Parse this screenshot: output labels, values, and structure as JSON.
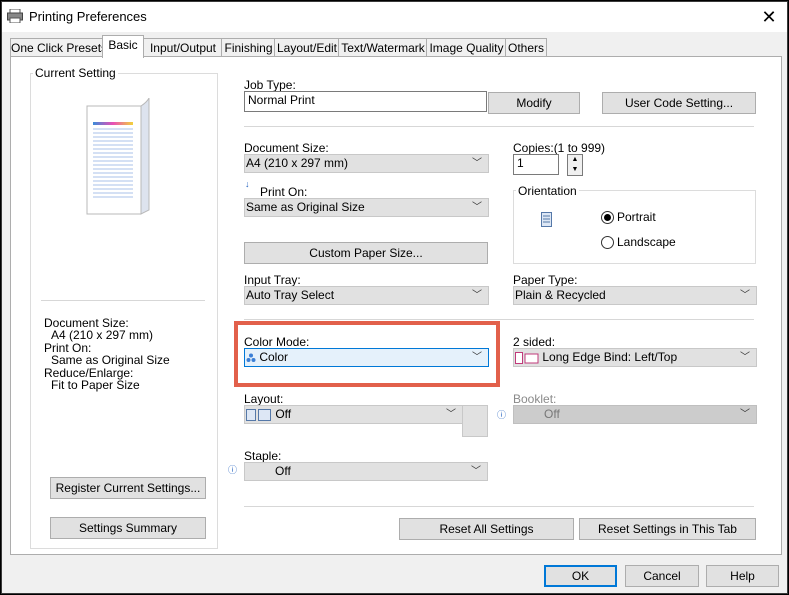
{
  "window": {
    "title": "Printing Preferences",
    "close_label": "✕"
  },
  "tabs": [
    "One Click Presets",
    "Basic",
    "Input/Output",
    "Finishing",
    "Layout/Edit",
    "Text/Watermark",
    "Image Quality",
    "Others"
  ],
  "left": {
    "group_title": "Current Setting",
    "summary": {
      "doc_size_label": "Document Size:",
      "doc_size_value": "A4 (210 x 297 mm)",
      "print_on_label": "Print On:",
      "print_on_value": "Same as Original Size",
      "reduce_label": "Reduce/Enlarge:",
      "reduce_value": "Fit to Paper Size"
    },
    "register_button": "Register Current Settings...",
    "summary_button": "Settings Summary"
  },
  "main": {
    "job_type_label": "Job Type:",
    "job_type_value": "Normal Print",
    "modify_button": "Modify",
    "user_code_button": "User Code Setting...",
    "document_size_label": "Document Size:",
    "document_size_value": "A4 (210 x 297 mm)",
    "copies_label": "Copies:(1 to 999)",
    "copies_value": "1",
    "print_on_label": "Print On:",
    "print_on_value": "Same as Original Size",
    "orientation_label": "Orientation",
    "portrait_label": "Portrait",
    "landscape_label": "Landscape",
    "custom_paper_button": "Custom Paper Size...",
    "input_tray_label": "Input Tray:",
    "input_tray_value": "Auto Tray Select",
    "paper_type_label": "Paper Type:",
    "paper_type_value": "Plain & Recycled",
    "color_mode_label": "Color Mode:",
    "color_mode_value": "Color",
    "two_sided_label": "2 sided:",
    "two_sided_value": "Long Edge Bind: Left/Top",
    "layout_label": "Layout:",
    "layout_value": "Off",
    "booklet_label": "Booklet:",
    "booklet_value": "Off",
    "staple_label": "Staple:",
    "staple_value": "Off",
    "reset_all_button": "Reset All Settings",
    "reset_tab_button": "Reset Settings in This Tab"
  },
  "footer": {
    "ok": "OK",
    "cancel": "Cancel",
    "help": "Help"
  },
  "colors": {
    "highlight": "#e2604b",
    "accent": "#0078d7"
  }
}
